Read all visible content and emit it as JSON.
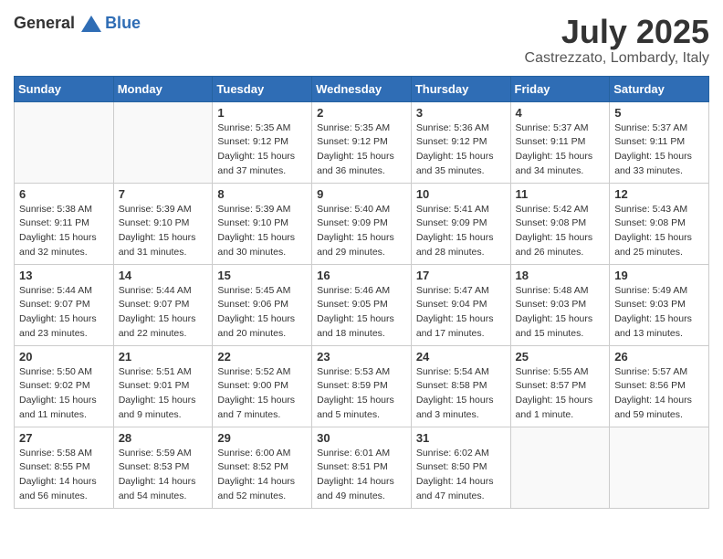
{
  "header": {
    "logo_general": "General",
    "logo_blue": "Blue",
    "month": "July 2025",
    "location": "Castrezzato, Lombardy, Italy"
  },
  "columns": [
    "Sunday",
    "Monday",
    "Tuesday",
    "Wednesday",
    "Thursday",
    "Friday",
    "Saturday"
  ],
  "weeks": [
    [
      {
        "day": "",
        "sunrise": "",
        "sunset": "",
        "daylight": ""
      },
      {
        "day": "",
        "sunrise": "",
        "sunset": "",
        "daylight": ""
      },
      {
        "day": "1",
        "sunrise": "Sunrise: 5:35 AM",
        "sunset": "Sunset: 9:12 PM",
        "daylight": "Daylight: 15 hours and 37 minutes."
      },
      {
        "day": "2",
        "sunrise": "Sunrise: 5:35 AM",
        "sunset": "Sunset: 9:12 PM",
        "daylight": "Daylight: 15 hours and 36 minutes."
      },
      {
        "day": "3",
        "sunrise": "Sunrise: 5:36 AM",
        "sunset": "Sunset: 9:12 PM",
        "daylight": "Daylight: 15 hours and 35 minutes."
      },
      {
        "day": "4",
        "sunrise": "Sunrise: 5:37 AM",
        "sunset": "Sunset: 9:11 PM",
        "daylight": "Daylight: 15 hours and 34 minutes."
      },
      {
        "day": "5",
        "sunrise": "Sunrise: 5:37 AM",
        "sunset": "Sunset: 9:11 PM",
        "daylight": "Daylight: 15 hours and 33 minutes."
      }
    ],
    [
      {
        "day": "6",
        "sunrise": "Sunrise: 5:38 AM",
        "sunset": "Sunset: 9:11 PM",
        "daylight": "Daylight: 15 hours and 32 minutes."
      },
      {
        "day": "7",
        "sunrise": "Sunrise: 5:39 AM",
        "sunset": "Sunset: 9:10 PM",
        "daylight": "Daylight: 15 hours and 31 minutes."
      },
      {
        "day": "8",
        "sunrise": "Sunrise: 5:39 AM",
        "sunset": "Sunset: 9:10 PM",
        "daylight": "Daylight: 15 hours and 30 minutes."
      },
      {
        "day": "9",
        "sunrise": "Sunrise: 5:40 AM",
        "sunset": "Sunset: 9:09 PM",
        "daylight": "Daylight: 15 hours and 29 minutes."
      },
      {
        "day": "10",
        "sunrise": "Sunrise: 5:41 AM",
        "sunset": "Sunset: 9:09 PM",
        "daylight": "Daylight: 15 hours and 28 minutes."
      },
      {
        "day": "11",
        "sunrise": "Sunrise: 5:42 AM",
        "sunset": "Sunset: 9:08 PM",
        "daylight": "Daylight: 15 hours and 26 minutes."
      },
      {
        "day": "12",
        "sunrise": "Sunrise: 5:43 AM",
        "sunset": "Sunset: 9:08 PM",
        "daylight": "Daylight: 15 hours and 25 minutes."
      }
    ],
    [
      {
        "day": "13",
        "sunrise": "Sunrise: 5:44 AM",
        "sunset": "Sunset: 9:07 PM",
        "daylight": "Daylight: 15 hours and 23 minutes."
      },
      {
        "day": "14",
        "sunrise": "Sunrise: 5:44 AM",
        "sunset": "Sunset: 9:07 PM",
        "daylight": "Daylight: 15 hours and 22 minutes."
      },
      {
        "day": "15",
        "sunrise": "Sunrise: 5:45 AM",
        "sunset": "Sunset: 9:06 PM",
        "daylight": "Daylight: 15 hours and 20 minutes."
      },
      {
        "day": "16",
        "sunrise": "Sunrise: 5:46 AM",
        "sunset": "Sunset: 9:05 PM",
        "daylight": "Daylight: 15 hours and 18 minutes."
      },
      {
        "day": "17",
        "sunrise": "Sunrise: 5:47 AM",
        "sunset": "Sunset: 9:04 PM",
        "daylight": "Daylight: 15 hours and 17 minutes."
      },
      {
        "day": "18",
        "sunrise": "Sunrise: 5:48 AM",
        "sunset": "Sunset: 9:03 PM",
        "daylight": "Daylight: 15 hours and 15 minutes."
      },
      {
        "day": "19",
        "sunrise": "Sunrise: 5:49 AM",
        "sunset": "Sunset: 9:03 PM",
        "daylight": "Daylight: 15 hours and 13 minutes."
      }
    ],
    [
      {
        "day": "20",
        "sunrise": "Sunrise: 5:50 AM",
        "sunset": "Sunset: 9:02 PM",
        "daylight": "Daylight: 15 hours and 11 minutes."
      },
      {
        "day": "21",
        "sunrise": "Sunrise: 5:51 AM",
        "sunset": "Sunset: 9:01 PM",
        "daylight": "Daylight: 15 hours and 9 minutes."
      },
      {
        "day": "22",
        "sunrise": "Sunrise: 5:52 AM",
        "sunset": "Sunset: 9:00 PM",
        "daylight": "Daylight: 15 hours and 7 minutes."
      },
      {
        "day": "23",
        "sunrise": "Sunrise: 5:53 AM",
        "sunset": "Sunset: 8:59 PM",
        "daylight": "Daylight: 15 hours and 5 minutes."
      },
      {
        "day": "24",
        "sunrise": "Sunrise: 5:54 AM",
        "sunset": "Sunset: 8:58 PM",
        "daylight": "Daylight: 15 hours and 3 minutes."
      },
      {
        "day": "25",
        "sunrise": "Sunrise: 5:55 AM",
        "sunset": "Sunset: 8:57 PM",
        "daylight": "Daylight: 15 hours and 1 minute."
      },
      {
        "day": "26",
        "sunrise": "Sunrise: 5:57 AM",
        "sunset": "Sunset: 8:56 PM",
        "daylight": "Daylight: 14 hours and 59 minutes."
      }
    ],
    [
      {
        "day": "27",
        "sunrise": "Sunrise: 5:58 AM",
        "sunset": "Sunset: 8:55 PM",
        "daylight": "Daylight: 14 hours and 56 minutes."
      },
      {
        "day": "28",
        "sunrise": "Sunrise: 5:59 AM",
        "sunset": "Sunset: 8:53 PM",
        "daylight": "Daylight: 14 hours and 54 minutes."
      },
      {
        "day": "29",
        "sunrise": "Sunrise: 6:00 AM",
        "sunset": "Sunset: 8:52 PM",
        "daylight": "Daylight: 14 hours and 52 minutes."
      },
      {
        "day": "30",
        "sunrise": "Sunrise: 6:01 AM",
        "sunset": "Sunset: 8:51 PM",
        "daylight": "Daylight: 14 hours and 49 minutes."
      },
      {
        "day": "31",
        "sunrise": "Sunrise: 6:02 AM",
        "sunset": "Sunset: 8:50 PM",
        "daylight": "Daylight: 14 hours and 47 minutes."
      },
      {
        "day": "",
        "sunrise": "",
        "sunset": "",
        "daylight": ""
      },
      {
        "day": "",
        "sunrise": "",
        "sunset": "",
        "daylight": ""
      }
    ]
  ]
}
